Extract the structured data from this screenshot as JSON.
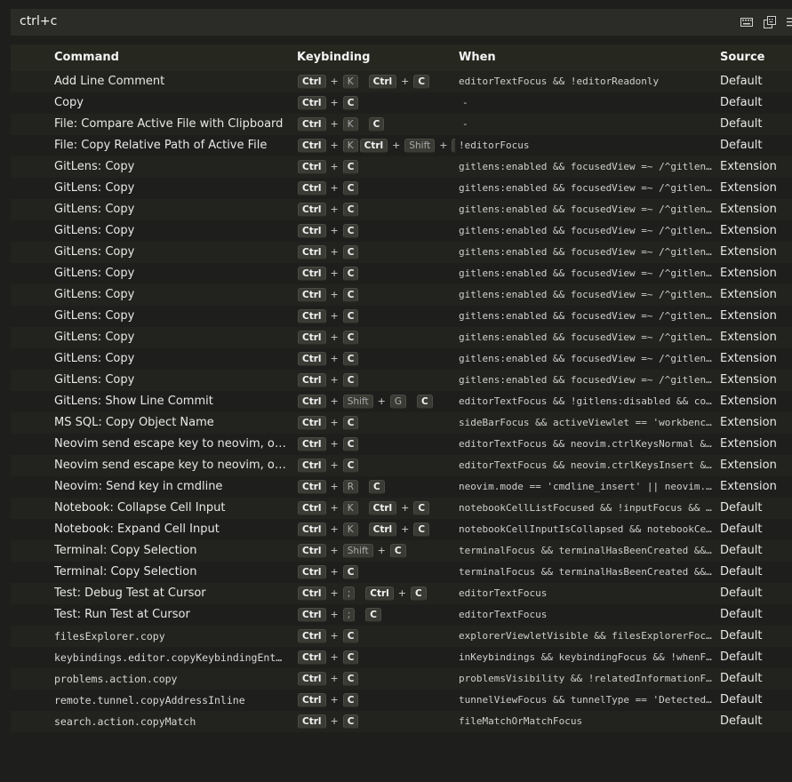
{
  "search": {
    "value": "ctrl+c"
  },
  "toolbar_icons": [
    "keyboard-icon",
    "record-keys-icon",
    "sort-by-precedence-icon"
  ],
  "headers": {
    "command": "Command",
    "keybinding": "Keybinding",
    "when": "When",
    "source": "Source"
  },
  "rows": [
    {
      "command": "Add Line Comment",
      "mono": false,
      "chords": [
        [
          "Ctrl",
          "K"
        ],
        [
          "Ctrl",
          "C"
        ]
      ],
      "when": "editorTextFocus && !editorReadonly",
      "source": "Default"
    },
    {
      "command": "Copy",
      "mono": false,
      "chords": [
        [
          "Ctrl",
          "C"
        ]
      ],
      "when": "-",
      "source": "Default"
    },
    {
      "command": "File: Compare Active File with Clipboard",
      "mono": false,
      "chords": [
        [
          "Ctrl",
          "K"
        ],
        [
          "C"
        ]
      ],
      "when": "-",
      "source": "Default"
    },
    {
      "command": "File: Copy Relative Path of Active File",
      "mono": false,
      "chords": [
        [
          "Ctrl",
          "K"
        ],
        [
          "Ctrl",
          "Shift",
          "C"
        ]
      ],
      "when": "!editorFocus",
      "source": "Default"
    },
    {
      "command": "GitLens: Copy",
      "mono": false,
      "chords": [
        [
          "Ctrl",
          "C"
        ]
      ],
      "when": "gitlens:enabled && focusedView =~ /^gitlens...",
      "source": "Extension"
    },
    {
      "command": "GitLens: Copy",
      "mono": false,
      "chords": [
        [
          "Ctrl",
          "C"
        ]
      ],
      "when": "gitlens:enabled && focusedView =~ /^gitlens...",
      "source": "Extension"
    },
    {
      "command": "GitLens: Copy",
      "mono": false,
      "chords": [
        [
          "Ctrl",
          "C"
        ]
      ],
      "when": "gitlens:enabled && focusedView =~ /^gitlens...",
      "source": "Extension"
    },
    {
      "command": "GitLens: Copy",
      "mono": false,
      "chords": [
        [
          "Ctrl",
          "C"
        ]
      ],
      "when": "gitlens:enabled && focusedView =~ /^gitlens...",
      "source": "Extension"
    },
    {
      "command": "GitLens: Copy",
      "mono": false,
      "chords": [
        [
          "Ctrl",
          "C"
        ]
      ],
      "when": "gitlens:enabled && focusedView =~ /^gitlens...",
      "source": "Extension"
    },
    {
      "command": "GitLens: Copy",
      "mono": false,
      "chords": [
        [
          "Ctrl",
          "C"
        ]
      ],
      "when": "gitlens:enabled && focusedView =~ /^gitlens...",
      "source": "Extension"
    },
    {
      "command": "GitLens: Copy",
      "mono": false,
      "chords": [
        [
          "Ctrl",
          "C"
        ]
      ],
      "when": "gitlens:enabled && focusedView =~ /^gitlens...",
      "source": "Extension"
    },
    {
      "command": "GitLens: Copy",
      "mono": false,
      "chords": [
        [
          "Ctrl",
          "C"
        ]
      ],
      "when": "gitlens:enabled && focusedView =~ /^gitlens...",
      "source": "Extension"
    },
    {
      "command": "GitLens: Copy",
      "mono": false,
      "chords": [
        [
          "Ctrl",
          "C"
        ]
      ],
      "when": "gitlens:enabled && focusedView =~ /^gitlens...",
      "source": "Extension"
    },
    {
      "command": "GitLens: Copy",
      "mono": false,
      "chords": [
        [
          "Ctrl",
          "C"
        ]
      ],
      "when": "gitlens:enabled && focusedView =~ /^gitlens...",
      "source": "Extension"
    },
    {
      "command": "GitLens: Copy",
      "mono": false,
      "chords": [
        [
          "Ctrl",
          "C"
        ]
      ],
      "when": "gitlens:enabled && focusedView =~ /^gitlens...",
      "source": "Extension"
    },
    {
      "command": "GitLens: Show Line Commit",
      "mono": false,
      "chords": [
        [
          "Ctrl",
          "Shift",
          "G"
        ],
        [
          "C"
        ]
      ],
      "when": "editorTextFocus && !gitlens:disabled && con...",
      "source": "Extension"
    },
    {
      "command": "MS SQL: Copy Object Name",
      "mono": false,
      "chords": [
        [
          "Ctrl",
          "C"
        ]
      ],
      "when": "sideBarFocus && activeViewlet == 'workbench...",
      "source": "Extension"
    },
    {
      "command": "Neovim send escape key to neovim, or othe...",
      "mono": false,
      "chords": [
        [
          "Ctrl",
          "C"
        ]
      ],
      "when": "editorTextFocus && neovim.ctrlKeysNormal &&...",
      "source": "Extension"
    },
    {
      "command": "Neovim send escape key to neovim, or othe...",
      "mono": false,
      "chords": [
        [
          "Ctrl",
          "C"
        ]
      ],
      "when": "editorTextFocus && neovim.ctrlKeysInsert &&...",
      "source": "Extension"
    },
    {
      "command": "Neovim: Send key in cmdline",
      "mono": false,
      "chords": [
        [
          "Ctrl",
          "R"
        ],
        [
          "C"
        ]
      ],
      "when": "neovim.mode == 'cmdline_insert' || neovim.m...",
      "source": "Extension"
    },
    {
      "command": "Notebook: Collapse Cell Input",
      "mono": false,
      "chords": [
        [
          "Ctrl",
          "K"
        ],
        [
          "Ctrl",
          "C"
        ]
      ],
      "when": "notebookCellListFocused && !inputFocus && !...",
      "source": "Default"
    },
    {
      "command": "Notebook: Expand Cell Input",
      "mono": false,
      "chords": [
        [
          "Ctrl",
          "K"
        ],
        [
          "Ctrl",
          "C"
        ]
      ],
      "when": "notebookCellInputIsCollapsed && notebookCel...",
      "source": "Default"
    },
    {
      "command": "Terminal: Copy Selection",
      "mono": false,
      "chords": [
        [
          "Ctrl",
          "Shift",
          "C"
        ]
      ],
      "when": "terminalFocus && terminalHasBeenCreated && ...",
      "source": "Default"
    },
    {
      "command": "Terminal: Copy Selection",
      "mono": false,
      "chords": [
        [
          "Ctrl",
          "C"
        ]
      ],
      "when": "terminalFocus && terminalHasBeenCreated && ...",
      "source": "Default"
    },
    {
      "command": "Test: Debug Test at Cursor",
      "mono": false,
      "chords": [
        [
          "Ctrl",
          ";"
        ],
        [
          "Ctrl",
          "C"
        ]
      ],
      "when": "editorTextFocus",
      "source": "Default"
    },
    {
      "command": "Test: Run Test at Cursor",
      "mono": false,
      "chords": [
        [
          "Ctrl",
          ";"
        ],
        [
          "C"
        ]
      ],
      "when": "editorTextFocus",
      "source": "Default"
    },
    {
      "command": "filesExplorer.copy",
      "mono": true,
      "chords": [
        [
          "Ctrl",
          "C"
        ]
      ],
      "when": "explorerViewletVisible && filesExplorerFocu...",
      "source": "Default"
    },
    {
      "command": "keybindings.editor.copyKeybindingEntry",
      "mono": true,
      "chords": [
        [
          "Ctrl",
          "C"
        ]
      ],
      "when": "inKeybindings && keybindingFocus && !whenFo...",
      "source": "Default"
    },
    {
      "command": "problems.action.copy",
      "mono": true,
      "chords": [
        [
          "Ctrl",
          "C"
        ]
      ],
      "when": "problemsVisibility && !relatedInformationFo...",
      "source": "Default"
    },
    {
      "command": "remote.tunnel.copyAddressInline",
      "mono": true,
      "chords": [
        [
          "Ctrl",
          "C"
        ]
      ],
      "when": "tunnelViewFocus && tunnelType == 'Detected'...",
      "source": "Default"
    },
    {
      "command": "search.action.copyMatch",
      "mono": true,
      "chords": [
        [
          "Ctrl",
          "C"
        ]
      ],
      "when": "fileMatchOrMatchFocus",
      "source": "Default"
    }
  ]
}
